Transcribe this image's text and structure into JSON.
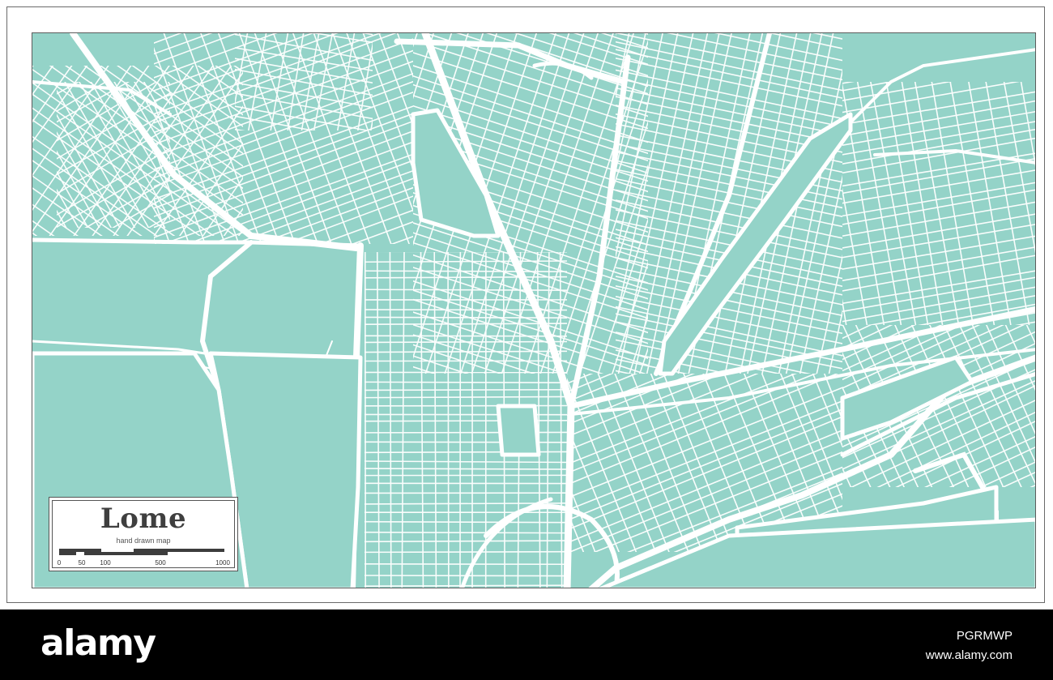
{
  "map": {
    "title": "Lome",
    "subtitle": "hand drawn map",
    "scale_labels": [
      "0",
      "50",
      "100",
      "500",
      "1000"
    ],
    "colors": {
      "land": "#94d3c8",
      "roads": "#ffffff",
      "border": "#555555"
    }
  },
  "watermark": {
    "logo": "alamy",
    "image_id": "PGRMWP",
    "url": "www.alamy.com"
  }
}
